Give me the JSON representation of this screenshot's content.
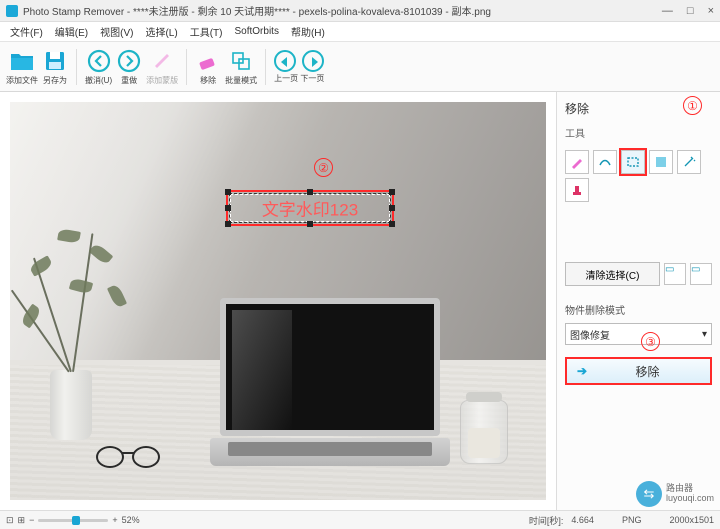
{
  "window": {
    "title": "Photo Stamp Remover - ****未注册版 - 剩余 10 天试用期**** - pexels-polina-kovaleva-8101039 - 副本.png",
    "min": "—",
    "max": "□",
    "close": "×"
  },
  "menu": {
    "file": "文件(F)",
    "edit": "编辑(E)",
    "view": "视图(V)",
    "select": "选择(L)",
    "tools": "工具(T)",
    "softorbits": "SoftOrbits",
    "help": "帮助(H)"
  },
  "toolbar": {
    "add_file": "添加文件",
    "save_as": "另存为",
    "undo": "撤消(U)",
    "redo": "重做",
    "add_zone": "添加蒙版",
    "remove": "移除",
    "batch": "批量模式",
    "prev": "上一页",
    "next": "下一页"
  },
  "watermark": {
    "text": "文字水印123"
  },
  "annotations": {
    "n1": "①",
    "n2": "②",
    "n3": "③"
  },
  "side": {
    "title": "移除",
    "tools_label": "工具",
    "clear_btn": "清除选择(C)",
    "mode_label": "物件删除模式",
    "mode_value": "图像修复",
    "remove_btn": "移除"
  },
  "status": {
    "zoom": "52%",
    "time_label": "时间[秒]:",
    "time_value": "4.664",
    "format": "PNG",
    "dims": "2000x1501"
  },
  "logo": {
    "brand": "路由器",
    "site": "luyouqi.com"
  }
}
